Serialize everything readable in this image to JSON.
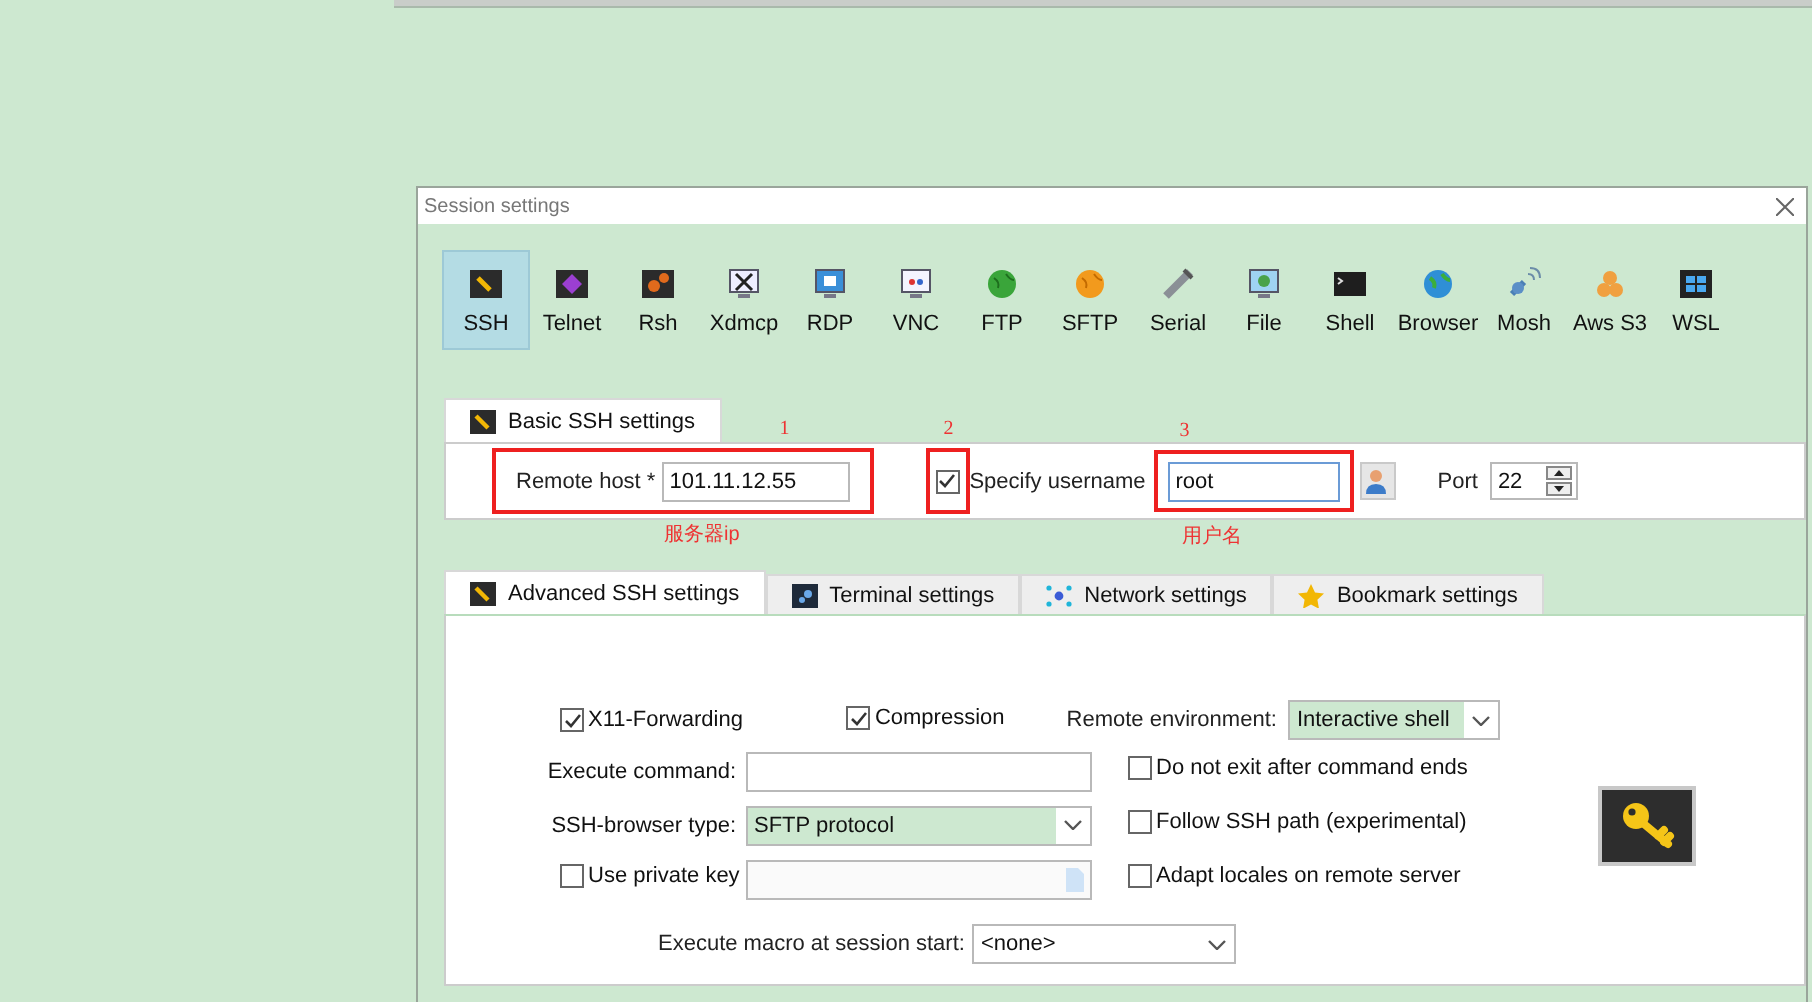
{
  "window": {
    "title": "Session settings"
  },
  "protocols": [
    {
      "label": "SSH",
      "selected": true
    },
    {
      "label": "Telnet",
      "selected": false
    },
    {
      "label": "Rsh",
      "selected": false
    },
    {
      "label": "Xdmcp",
      "selected": false
    },
    {
      "label": "RDP",
      "selected": false
    },
    {
      "label": "VNC",
      "selected": false
    },
    {
      "label": "FTP",
      "selected": false
    },
    {
      "label": "SFTP",
      "selected": false
    },
    {
      "label": "Serial",
      "selected": false
    },
    {
      "label": "File",
      "selected": false
    },
    {
      "label": "Shell",
      "selected": false
    },
    {
      "label": "Browser",
      "selected": false
    },
    {
      "label": "Mosh",
      "selected": false
    },
    {
      "label": "Aws S3",
      "selected": false
    },
    {
      "label": "WSL",
      "selected": false
    }
  ],
  "basic_tab": {
    "label": "Basic SSH settings",
    "selected": true
  },
  "basic": {
    "remote_host_label": "Remote host *",
    "remote_host": "101.11.12.55",
    "specify_username": {
      "label": "Specify username",
      "checked": true
    },
    "username": "root",
    "port_label": "Port",
    "port": "22"
  },
  "annotations": [
    {
      "number": "1",
      "caption": "服务器ip"
    },
    {
      "number": "2"
    },
    {
      "number": "3",
      "caption": "用户名"
    }
  ],
  "advanced_tabs": [
    {
      "label": "Advanced SSH settings",
      "selected": true
    },
    {
      "label": "Terminal settings",
      "selected": false
    },
    {
      "label": "Network settings",
      "selected": false
    },
    {
      "label": "Bookmark settings",
      "selected": false
    }
  ],
  "advanced": {
    "x11": {
      "label": "X11-Forwarding",
      "checked": true
    },
    "compression": {
      "label": "Compression",
      "checked": true
    },
    "remote_env_label": "Remote environment:",
    "remote_env": "Interactive shell",
    "execute_command_label": "Execute command:",
    "ssh_browser_label": "SSH-browser type:",
    "ssh_browser": "SFTP protocol",
    "private_key": {
      "label": "Use private key",
      "checked": false
    },
    "options": [
      {
        "label": "Do not exit after command ends",
        "checked": false
      },
      {
        "label": "Follow SSH path (experimental)",
        "checked": false
      },
      {
        "label": "Adapt locales on remote server",
        "checked": false
      }
    ],
    "macro_label": "Execute macro at session start:",
    "macro": "<none>"
  }
}
